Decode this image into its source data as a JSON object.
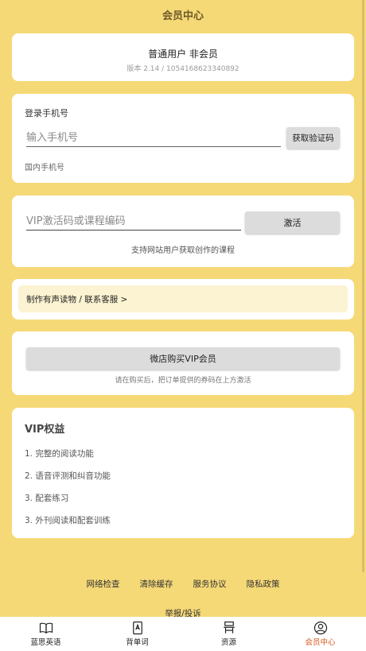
{
  "header": {
    "title": "会员中心"
  },
  "user": {
    "type": "普通用户 非会员",
    "version": "版本 2.14 / 1054168623340892"
  },
  "login": {
    "title": "登录手机号",
    "phone_placeholder": "输入手机号",
    "get_code_label": "获取验证码",
    "hint": "国内手机号"
  },
  "vip": {
    "code_placeholder": "VIP激活码或课程编码",
    "activate_label": "激活",
    "hint": "支持网站用户获取创作的课程"
  },
  "service": {
    "link": "制作有声读物 / 联系客服 >"
  },
  "buy": {
    "button_label": "微店购买VIP会员",
    "hint": "请在购买后，把订单提供的券码在上方激活"
  },
  "benefits": {
    "title": "VIP权益",
    "items": [
      "1. 完整的阅读功能",
      "2. 语音评测和纠音功能",
      "3. 配套练习",
      "3. 外刊阅读和配套训练"
    ]
  },
  "footer": {
    "links": [
      "网络检查",
      "清除缓存",
      "服务协议",
      "隐私政策"
    ],
    "report": "举报/投诉"
  },
  "nav": {
    "items": [
      {
        "label": "蓝思英语",
        "icon": "book-icon"
      },
      {
        "label": "背单词",
        "icon": "wordbook-icon"
      },
      {
        "label": "资源",
        "icon": "desk-icon"
      },
      {
        "label": "会员中心",
        "icon": "user-icon"
      }
    ],
    "active_color": "#D9531E"
  },
  "colors": {
    "background": "#F6D977",
    "card": "#FFFFFF",
    "service_bg": "#FBF3D1",
    "button": "#DCDCDC"
  }
}
